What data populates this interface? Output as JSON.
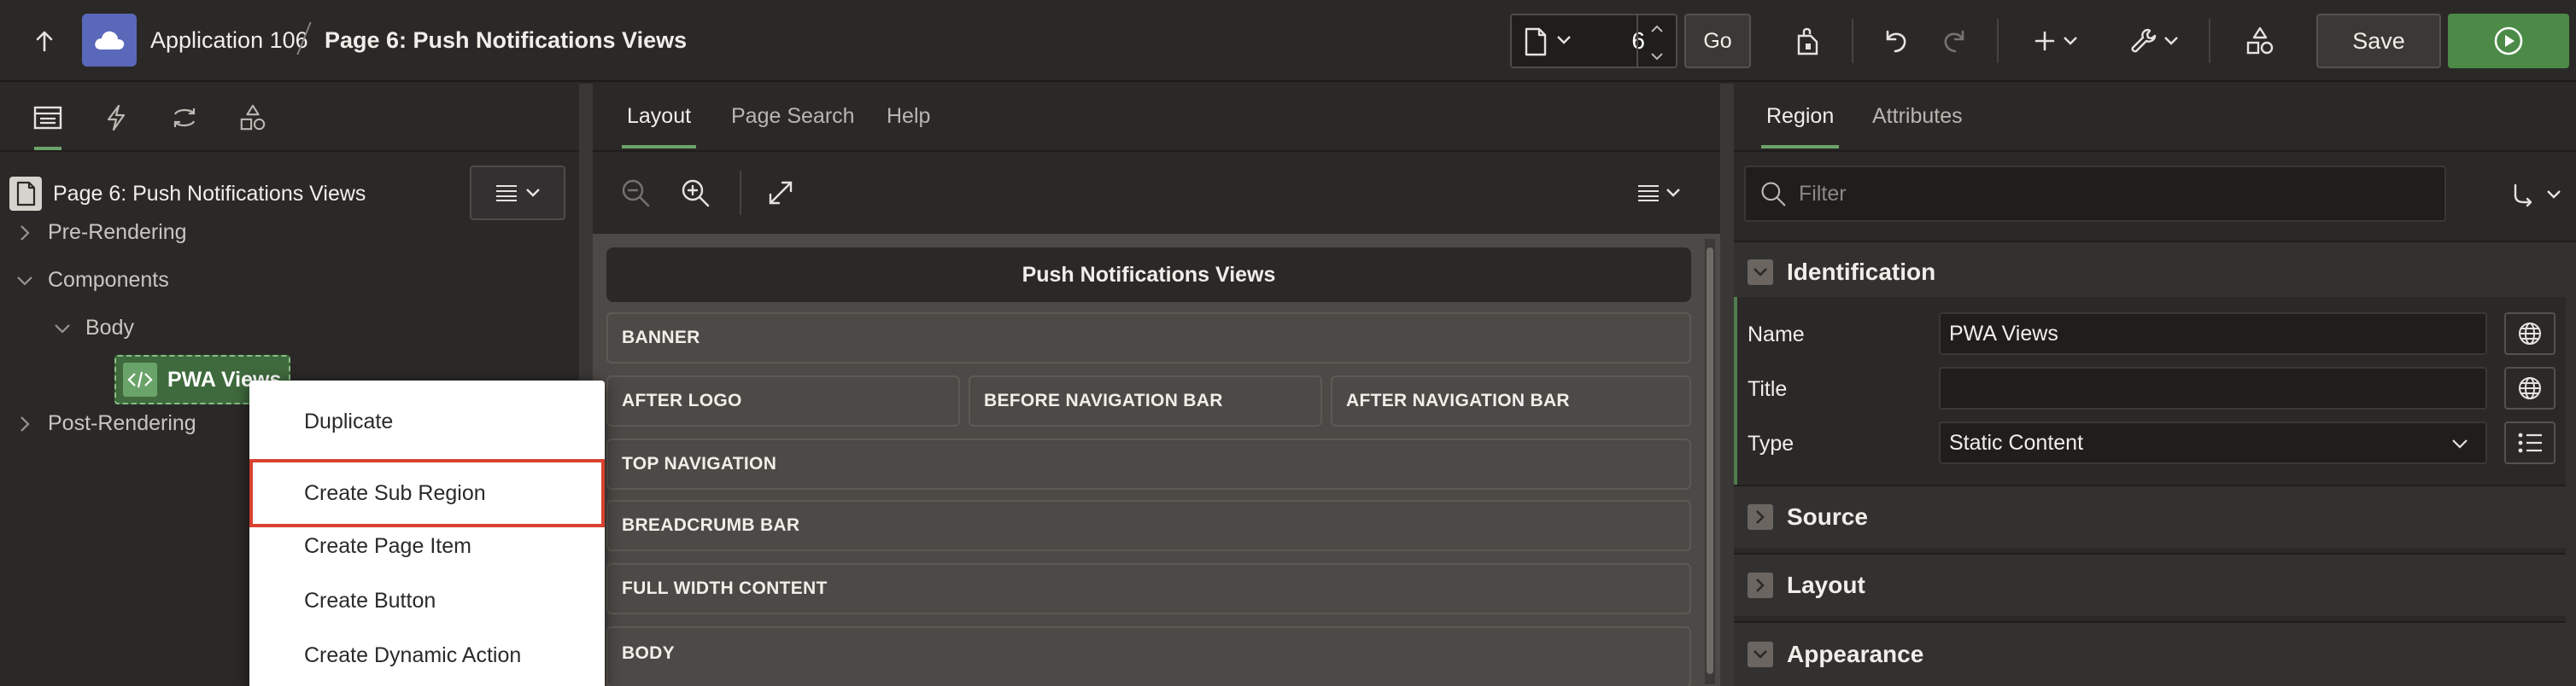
{
  "header": {
    "app_name": "Application 106",
    "page_title": "Page 6: Push Notifications Views",
    "page_number": "6",
    "go_label": "Go",
    "save_label": "Save"
  },
  "left_pane": {
    "tabs": [
      "rendering",
      "dynamic-actions",
      "processing",
      "shared-components"
    ],
    "root_label": "Page 6: Push Notifications Views",
    "tree": {
      "pre_rendering": "Pre-Rendering",
      "components": "Components",
      "body": "Body",
      "pwa_views": "PWA Views",
      "post_rendering": "Post-Rendering"
    }
  },
  "context_menu": {
    "items": [
      "Duplicate",
      "Create Sub Region",
      "Create Page Item",
      "Create Button",
      "Create Dynamic Action"
    ],
    "highlighted": "Create Sub Region"
  },
  "center_pane": {
    "tabs": [
      "Layout",
      "Page Search",
      "Help"
    ],
    "active_tab": "Layout",
    "canvas_title": "Push Notifications Views",
    "regions": {
      "banner": "BANNER",
      "after_logo": "AFTER LOGO",
      "before_navigation_bar": "BEFORE NAVIGATION BAR",
      "after_navigation_bar": "AFTER NAVIGATION BAR",
      "top_navigation": "TOP NAVIGATION",
      "breadcrumb_bar": "BREADCRUMB BAR",
      "full_width_content": "FULL WIDTH CONTENT",
      "body": "BODY"
    }
  },
  "right_pane": {
    "tabs": [
      "Region",
      "Attributes"
    ],
    "active_tab": "Region",
    "filter_placeholder": "Filter",
    "sections": {
      "identification": "Identification",
      "source": "Source",
      "layout": "Layout",
      "appearance": "Appearance"
    },
    "properties": {
      "name_label": "Name",
      "name_value": "PWA Views",
      "title_label": "Title",
      "title_value": "",
      "type_label": "Type",
      "type_value": "Static Content"
    }
  },
  "colors": {
    "accent_green": "#6aa36a",
    "run_button": "#4b8a47",
    "app_icon": "#5968b9",
    "highlight_red": "#d8422e"
  }
}
